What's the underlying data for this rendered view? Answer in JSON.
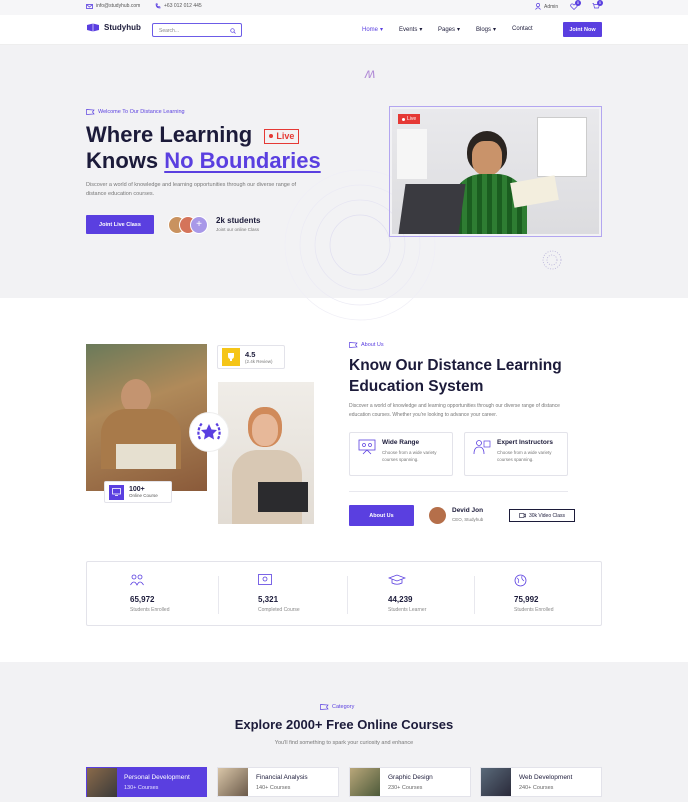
{
  "topbar": {
    "email": "info@studyhub.com",
    "phone": "+63 012 012 445",
    "admin": "Admin",
    "wishlist_count": "0",
    "cart_count": "0"
  },
  "nav": {
    "logo": "Studyhub",
    "search_placeholder": "Search...",
    "items": [
      "Home",
      "Events",
      "Pages",
      "Blogs",
      "Contact"
    ],
    "cta": "Joint Now"
  },
  "hero": {
    "eyebrow": "Welcome To Our Distance Learning",
    "title_line1": "Where Learning",
    "live_badge": "Live",
    "title_line2_plain": "Knows ",
    "title_line2_accent": "No Boundaries",
    "description": "Discover a world of knowledge and learning opportunities through our diverse range of distance education courses.",
    "cta": "Joint Live Class",
    "students_count": "2k students",
    "students_sub": "Joint our online Class",
    "video_live": "Live"
  },
  "about": {
    "eyebrow": "About Us",
    "title_line1": "Know Our Distance Learning",
    "title_line2": "Education System",
    "description": "Discover a world of knowledge and learning opportunities through our diverse range of distance education courses. Whether you're looking to advance your career.",
    "rating": "4.5",
    "rating_sub": "(2.4k Review)",
    "online_count": "100+",
    "online_label": "Online Course",
    "features": [
      {
        "title": "Wide Range",
        "desc": "Choose from a wide variety courses spanning."
      },
      {
        "title": "Expert Instructors",
        "desc": "Choose from a wide variety courses spanning."
      }
    ],
    "cta": "About Us",
    "person_name": "Devid Jon",
    "person_role": "CEO, Studyhub",
    "video_class": "30k Video Class"
  },
  "stats": [
    {
      "value": "65,972",
      "label": "Students Enrolled"
    },
    {
      "value": "5,321",
      "label": "Completed Course"
    },
    {
      "value": "44,239",
      "label": "Students Learner"
    },
    {
      "value": "75,992",
      "label": "Students Enrolled"
    }
  ],
  "category": {
    "eyebrow": "Category",
    "title": "Explore 2000+ Free Online Courses",
    "subtitle": "You'll find something to spark your curiosity and enhance",
    "items": [
      {
        "title": "Personal Development",
        "count": "130+ Courses"
      },
      {
        "title": "Financial Analysis",
        "count": "140+ Courses"
      },
      {
        "title": "Graphic Design",
        "count": "230+ Courses"
      },
      {
        "title": "Web Development",
        "count": "240+ Courses"
      }
    ]
  },
  "colors": {
    "accent": "#5a3fe0",
    "live": "#e53935",
    "dark": "#1c1b3a"
  }
}
